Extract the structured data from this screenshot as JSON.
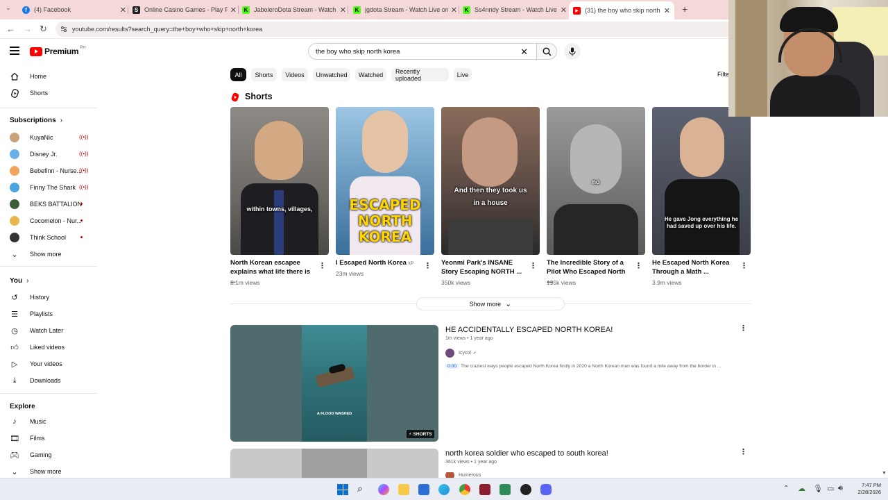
{
  "tabs": [
    {
      "label": "(4) Facebook",
      "favicon_color": "#1877f2",
      "favicon_glyph": "f"
    },
    {
      "label": "Online Casino Games - Play Free",
      "favicon_color": "#222222",
      "favicon_glyph": "S"
    },
    {
      "label": "JaboleroDota Stream - Watch Live",
      "favicon_color": "#53fc18",
      "favicon_glyph": "K"
    },
    {
      "label": "jgdota Stream - Watch Live on Kick",
      "favicon_color": "#53fc18",
      "favicon_glyph": "K"
    },
    {
      "label": "Ss4nndy Stream - Watch Live on Kick",
      "favicon_color": "#53fc18",
      "favicon_glyph": "K"
    },
    {
      "label": "(31) the boy who skip north korea",
      "favicon_color": "#ff0000",
      "favicon_glyph": "▶"
    }
  ],
  "close_glyph": "✕",
  "new_tab_glyph": "+",
  "address": {
    "url": "youtube.com/results?search_query=the+boy+who+skip+north+korea"
  },
  "header": {
    "logo": "Premium",
    "region": "PH",
    "search_value": "the boy who skip north korea"
  },
  "chips": [
    "All",
    "Shorts",
    "Videos",
    "Unwatched",
    "Watched",
    "Recently uploaded",
    "Live"
  ],
  "filters_label": "Filte",
  "sidebar": {
    "main": [
      {
        "label": "Home",
        "icon": "home-icon"
      },
      {
        "label": "Shorts",
        "icon": "shorts-icon"
      }
    ],
    "subscriptions_title": "Subscriptions",
    "subscriptions": [
      {
        "label": "KuyaNic",
        "status": "live",
        "color": "#c9a27a"
      },
      {
        "label": "Disney Jr.",
        "status": "live",
        "color": "#6ab0e8"
      },
      {
        "label": "Bebefinn - Nurse...",
        "status": "live",
        "color": "#f2a35c"
      },
      {
        "label": "Finny The Shark",
        "status": "live",
        "color": "#4aa3df"
      },
      {
        "label": "BEKS BATTALION",
        "status": "new",
        "color": "#3c5f3a"
      },
      {
        "label": "Cocomelon - Nur...",
        "status": "new",
        "color": "#e8b64c"
      },
      {
        "label": "Think School",
        "status": "new",
        "color": "#333333"
      }
    ],
    "show_more": "Show more",
    "you_title": "You",
    "you_items": [
      {
        "label": "History",
        "icon": "history-icon"
      },
      {
        "label": "Playlists",
        "icon": "playlists-icon"
      },
      {
        "label": "Watch Later",
        "icon": "watch-later-icon"
      },
      {
        "label": "Liked videos",
        "icon": "like-icon"
      },
      {
        "label": "Your videos",
        "icon": "your-videos-icon"
      },
      {
        "label": "Downloads",
        "icon": "download-icon"
      }
    ],
    "explore_title": "Explore",
    "explore_items": [
      {
        "label": "Music",
        "icon": "music-icon"
      },
      {
        "label": "Films",
        "icon": "films-icon"
      },
      {
        "label": "Gaming",
        "icon": "gaming-icon"
      }
    ],
    "show_more_2": "Show more"
  },
  "shorts_section": {
    "title": "Shorts",
    "items": [
      {
        "title_line1": "North Korean escapee",
        "title_line2": "explains what life there is ...",
        "views": "8.1m views",
        "caption": "within towns, villages,",
        "bg": "#6d6a66"
      },
      {
        "title_line1": "I Escaped North Korea",
        "title_suffix": "KP",
        "views": "23m views",
        "caption": "ESCAPED NORTH KOREA",
        "bg": "#3a6f9c"
      },
      {
        "title_line1": "Yeonmi Park's INSANE",
        "title_line2": "Story Escaping NORTH ...",
        "views": "350k views",
        "caption": "And then they took us in a house",
        "bg": "#5b4a44"
      },
      {
        "title_line1": "The Incredible Story of a",
        "title_line2": "Pilot Who Escaped North ...",
        "views": "195k views",
        "caption": "no",
        "bg": "#5a5a5a"
      },
      {
        "title_line1": "He Escaped North Korea",
        "title_line2": "Through a Math ...",
        "views": "3.9m views",
        "caption": "He gave Jong everything he had saved up over his life.",
        "bg": "#3b3e48"
      }
    ],
    "show_more": "Show more"
  },
  "videos": [
    {
      "title": "HE ACCIDENTALLY ESCAPED NORTH KOREA!",
      "views": "1m views",
      "age": "1 year ago",
      "channel": "Icycol",
      "timestamp": "0:00",
      "snippet": "The craziest ways people escaped North Korea firstly in 2020 a North Korean man was found a mile away from the border in ...",
      "overlay": "A FLOOD WASHED",
      "badge": "SHORTS"
    },
    {
      "title": "north korea soldier who escaped to south korea!",
      "views": "361k views",
      "age": "1 year ago",
      "channel": "Humerous"
    }
  ],
  "clock": {
    "time": "7:47 PM",
    "date": "2/28/2026"
  }
}
